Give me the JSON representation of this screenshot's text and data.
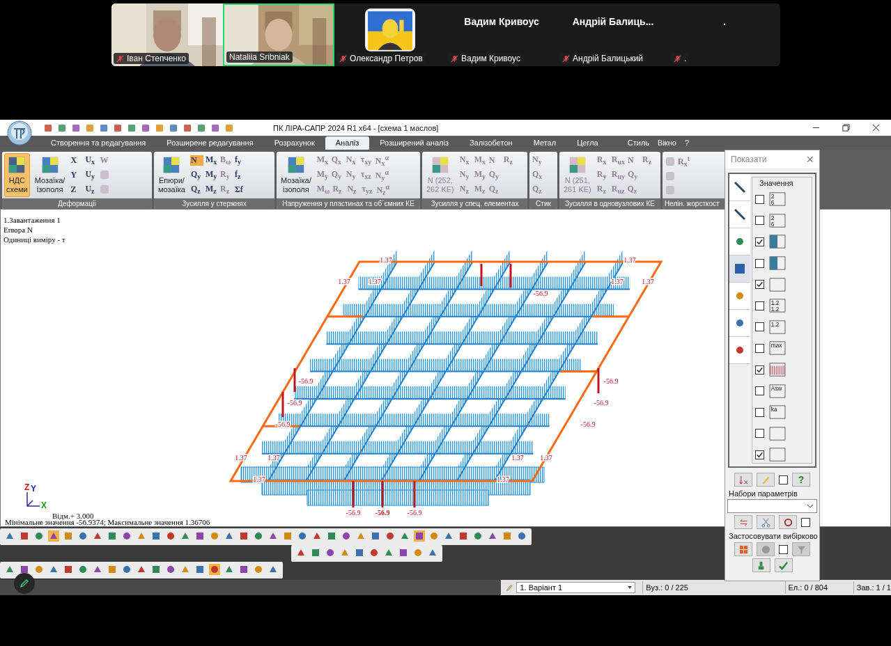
{
  "meeting": {
    "participants": [
      {
        "kind": "video",
        "caption": "Іван Степченко",
        "muted": true,
        "selected": false
      },
      {
        "kind": "video",
        "caption": "Nataliia Sribniak",
        "muted": false,
        "selected": true
      },
      {
        "kind": "avatar",
        "caption": "Олександр Петров",
        "muted": true,
        "selected": false
      },
      {
        "kind": "name",
        "display": "Вадим Кривоус",
        "caption": "Вадим Кривоус",
        "muted": true,
        "selected": false
      },
      {
        "kind": "name",
        "display": "Андрій  Балиць...",
        "caption": "Андрій Балицький",
        "muted": true,
        "selected": false
      },
      {
        "kind": "name",
        "display": ".",
        "caption": ".",
        "muted": true,
        "selected": false
      }
    ]
  },
  "window": {
    "title": "ПК ЛІРА-САПР  2024 R1 x64 - [схема 1 маслов]"
  },
  "tabs": [
    {
      "label": "Створення та редагування",
      "selected": false
    },
    {
      "label": "Розширене редагування",
      "selected": false
    },
    {
      "label": "Розрахунок",
      "selected": false
    },
    {
      "label": "Аналіз",
      "selected": true
    },
    {
      "label": "Розширений аналіз",
      "selected": false
    },
    {
      "label": "Залізобетон",
      "selected": false
    },
    {
      "label": "Метал",
      "selected": false
    },
    {
      "label": "Цегла",
      "selected": false
    }
  ],
  "menu_right": [
    "Стиль",
    "Вікно",
    "?"
  ],
  "ribbon": [
    {
      "label": "Деформації",
      "big": [
        {
          "lines": [
            "НДС",
            "схеми"
          ],
          "selected": true,
          "disabled": false
        },
        {
          "lines": [
            "Мозаїка/",
            "ізополя"
          ],
          "selected": false,
          "disabled": false
        }
      ],
      "rows": [
        [
          {
            "text": "X",
            "selected": false,
            "disabled": false
          },
          {
            "text": "U$_{x}$",
            "selected": false,
            "disabled": false
          },
          {
            "text": "W",
            "selected": false,
            "disabled": true
          }
        ],
        [
          {
            "text": "Y",
            "selected": false,
            "disabled": false
          },
          {
            "text": "U$_{y}$",
            "selected": false,
            "disabled": false
          },
          {
            "selected": false,
            "disabled": true
          }
        ],
        [
          {
            "text": "Z",
            "selected": false,
            "disabled": false
          },
          {
            "text": "U$_{z}$",
            "selected": false,
            "disabled": false
          },
          {
            "selected": false,
            "disabled": true
          }
        ]
      ]
    },
    {
      "label": "Зусилля у стержнях",
      "big": [
        {
          "lines": [
            "Епюри/",
            "мозаїка"
          ],
          "selected": false,
          "disabled": false
        }
      ],
      "rows": [
        [
          {
            "text": "N",
            "selected": true,
            "disabled": false
          },
          {
            "text": "M$_{x}$",
            "selected": false,
            "disabled": false
          },
          {
            "text": "B$_{ω}$",
            "selected": false,
            "disabled": true
          },
          {
            "text": "f$_{y}$",
            "selected": false,
            "disabled": false
          }
        ],
        [
          {
            "text": "Q$_{y}$",
            "selected": false,
            "disabled": false
          },
          {
            "text": "M$_{y}$",
            "selected": false,
            "disabled": false
          },
          {
            "text": "R$_{y}$",
            "selected": false,
            "disabled": true
          },
          {
            "text": "f$_{z}$",
            "selected": false,
            "disabled": false
          }
        ],
        [
          {
            "text": "Q$_{z}$",
            "selected": false,
            "disabled": false
          },
          {
            "text": "M$_{z}$",
            "selected": false,
            "disabled": false
          },
          {
            "text": "R$_{z}$",
            "selected": false,
            "disabled": true
          },
          {
            "text": "Σf",
            "selected": false,
            "disabled": false
          }
        ]
      ]
    },
    {
      "label": "Напруження у пластинах та об`ємних КЕ",
      "big": [
        {
          "lines": [
            "Мозаїка/",
            "ізополя"
          ],
          "selected": false,
          "disabled": false
        }
      ],
      "rows": [
        [
          {
            "text": "M$_{x}$",
            "selected": false,
            "disabled": true
          },
          {
            "text": "Q$_{x}$",
            "selected": false,
            "disabled": true
          },
          {
            "text": "N$_{x}$",
            "selected": false,
            "disabled": true
          },
          {
            "text": "τ$_{xy}$",
            "selected": false,
            "disabled": true
          },
          {
            "text": "N$_{x}$$^{α}$",
            "selected": false,
            "disabled": true
          }
        ],
        [
          {
            "text": "M$_{y}$",
            "selected": false,
            "disabled": true
          },
          {
            "text": "Q$_{y}$",
            "selected": false,
            "disabled": true
          },
          {
            "text": "N$_{y}$",
            "selected": false,
            "disabled": true
          },
          {
            "text": "τ$_{xz}$",
            "selected": false,
            "disabled": true
          },
          {
            "text": "N$_{y}$$^{α}$",
            "selected": false,
            "disabled": true
          }
        ],
        [
          {
            "text": "M$_{ω}$",
            "selected": false,
            "disabled": true
          },
          {
            "text": "R$_{z}$",
            "selected": false,
            "disabled": true
          },
          {
            "text": "N$_{z}$",
            "selected": false,
            "disabled": true
          },
          {
            "text": "τ$_{yz}$",
            "selected": false,
            "disabled": true
          },
          {
            "text": "N$_{z}$$^{α}$",
            "selected": false,
            "disabled": true
          }
        ]
      ]
    },
    {
      "label": "Зусилля у спец. елементах",
      "big": [
        {
          "lines": [
            "N (252,",
            "262 KE)"
          ],
          "selected": false,
          "disabled": true
        }
      ],
      "rows": [
        [
          {
            "text": "N$_{x}$",
            "selected": false,
            "disabled": true
          },
          {
            "text": "M$_{x}$",
            "selected": false,
            "disabled": true
          },
          {
            "text": "N",
            "selected": false,
            "disabled": true
          },
          {
            "text": "R$_{z}$",
            "selected": false,
            "disabled": true
          }
        ],
        [
          {
            "text": "N$_{y}$",
            "selected": false,
            "disabled": true
          },
          {
            "text": "M$_{y}$",
            "selected": false,
            "disabled": true
          },
          {
            "text": "Q$_{y}$",
            "selected": false,
            "disabled": true
          }
        ],
        [
          {
            "text": "N$_{z}$",
            "selected": false,
            "disabled": true
          },
          {
            "text": "M$_{z}$",
            "selected": false,
            "disabled": true
          },
          {
            "text": "Q$_{z}$",
            "selected": false,
            "disabled": true
          }
        ]
      ]
    },
    {
      "label": "Стик",
      "rows": [
        [
          {
            "text": "N$_{y}$",
            "selected": false,
            "disabled": true
          }
        ],
        [
          {
            "text": "Q$_{x}$",
            "selected": false,
            "disabled": true
          }
        ],
        [
          {
            "text": "Q$_{z}$",
            "selected": false,
            "disabled": true
          }
        ]
      ]
    },
    {
      "label": "Зусилля в одновузлових КЕ",
      "big": [
        {
          "lines": [
            "N (251,",
            "261 KE)"
          ],
          "selected": false,
          "disabled": true
        }
      ],
      "rows": [
        [
          {
            "text": "R$_{x}$",
            "selected": false,
            "disabled": true
          },
          {
            "text": "R$_{ux}$",
            "selected": false,
            "disabled": true
          },
          {
            "text": "N",
            "selected": false,
            "disabled": true
          },
          {
            "text": "R$_{z}$",
            "selected": false,
            "disabled": true
          }
        ],
        [
          {
            "text": "R$_{y}$",
            "selected": false,
            "disabled": true
          },
          {
            "text": "R$_{uy}$",
            "selected": false,
            "disabled": true
          },
          {
            "text": "Q$_{y}$",
            "selected": false,
            "disabled": true
          }
        ],
        [
          {
            "text": "R$_{z}$",
            "selected": false,
            "disabled": true
          },
          {
            "text": "R$_{uz}$",
            "selected": false,
            "disabled": true
          },
          {
            "text": "Q$_{z}$",
            "selected": false,
            "disabled": true
          }
        ]
      ]
    },
    {
      "label": "Нелін. жорсткост",
      "rows": [
        [
          {
            "selected": false,
            "disabled": true
          },
          {
            "text": "R$_{x}$$^{t}$",
            "selected": false,
            "disabled": true
          }
        ],
        [
          {
            "selected": false,
            "disabled": true
          }
        ],
        [
          {
            "selected": false,
            "disabled": true
          }
        ]
      ]
    }
  ],
  "canvas": {
    "info": [
      "1.Завантаження 1",
      "Епюра  N",
      "Одиниці виміру - т"
    ],
    "value_labels": [
      "1.37",
      "1.37",
      "1.37",
      "1.37",
      "1.37",
      "1.37",
      "-56.9",
      "-56.9",
      "-56.9",
      "-56.9",
      "-56.9",
      "-56.9",
      "-56.9",
      "1.37",
      "1.37",
      "1.37",
      "1.37",
      "1.37",
      "1.37",
      "-56.9",
      "-56.9",
      "-56.9"
    ],
    "axes": [
      "Z",
      "Y",
      "X"
    ],
    "elevation": "Відм.+ 3.000",
    "summary": "Мінімальне значення  -56.9374; Максимальне значення  1.36706"
  },
  "toolbars": [
    [
      {
        "selected": false
      },
      {
        "selected": false
      },
      {
        "selected": false
      },
      {
        "selected": true
      },
      {
        "selected": false
      },
      {
        "selected": false
      },
      {
        "selected": false
      },
      {
        "selected": false
      },
      {
        "selected": false
      },
      {
        "selected": false
      },
      {
        "selected": false
      },
      {
        "selected": false
      },
      {
        "selected": false
      },
      {
        "selected": false
      },
      {
        "selected": false
      },
      {
        "selected": false
      },
      {
        "selected": false
      },
      {
        "selected": false
      },
      {
        "selected": false
      },
      {
        "selected": false
      },
      {
        "selected": false
      },
      {
        "selected": false
      },
      {
        "selected": false
      },
      {
        "selected": false
      },
      {
        "selected": false
      },
      {
        "selected": false
      },
      {
        "selected": false
      },
      {
        "selected": false
      },
      {
        "selected": true
      },
      {
        "selected": false
      },
      {
        "selected": false
      },
      {
        "selected": false
      },
      {
        "selected": false
      },
      {
        "selected": false
      },
      {
        "selected": false
      },
      {
        "selected": false
      }
    ],
    [
      {
        "selected": false
      },
      {
        "selected": false
      },
      {
        "selected": false
      },
      {
        "selected": false
      },
      {
        "selected": false
      },
      {
        "selected": false
      },
      {
        "selected": false
      },
      {
        "selected": false
      },
      {
        "selected": false
      },
      {
        "selected": false
      }
    ],
    [
      {
        "selected": false
      },
      {
        "selected": false
      },
      {
        "selected": false
      },
      {
        "selected": false
      },
      {
        "selected": false
      },
      {
        "selected": false
      },
      {
        "selected": false
      },
      {
        "selected": false
      },
      {
        "selected": false
      },
      {
        "selected": false
      },
      {
        "selected": false
      },
      {
        "selected": false
      },
      {
        "selected": false
      },
      {
        "selected": false
      },
      {
        "selected": true
      },
      {
        "selected": false
      },
      {
        "selected": false
      },
      {
        "selected": false
      },
      {
        "selected": false
      }
    ]
  ],
  "status_bar": {
    "variant": "1. Варіант 1",
    "nodes": "Вуз.: 0 / 225",
    "elements": "Ел.: 0 / 804",
    "loads": "Зав.: 1 / 1"
  },
  "show_panel": {
    "title": "Показати",
    "close": "×",
    "side_tabs": [
      {
        "selected": false
      },
      {
        "selected": false
      },
      {
        "selected": false
      },
      {
        "selected": true
      },
      {
        "selected": false
      },
      {
        "selected": false
      },
      {
        "selected": false
      }
    ],
    "group": "Значення",
    "options": [
      {
        "checked": false,
        "glyph": [
          "2",
          "6"
        ]
      },
      {
        "checked": false,
        "glyph": [
          "2",
          "6"
        ]
      },
      {
        "checked": true
      },
      {
        "checked": false
      },
      {
        "checked": true
      },
      {
        "checked": false,
        "glyph": [
          "1.2",
          "1.2"
        ]
      },
      {
        "checked": false,
        "glyph": [
          "1.2"
        ]
      },
      {
        "checked": false,
        "glyph": [
          "max"
        ]
      },
      {
        "checked": true
      },
      {
        "checked": false,
        "glyph": [
          "Asw"
        ]
      },
      {
        "checked": false,
        "glyph": [
          "ka"
        ]
      },
      {
        "checked": false
      },
      {
        "checked": true
      }
    ],
    "edit_checked": false,
    "help": "?",
    "sets_label": "Набори параметрів",
    "sets_checked": false,
    "apply_label": "Застосовувати вибірково",
    "apply_checked": false
  }
}
